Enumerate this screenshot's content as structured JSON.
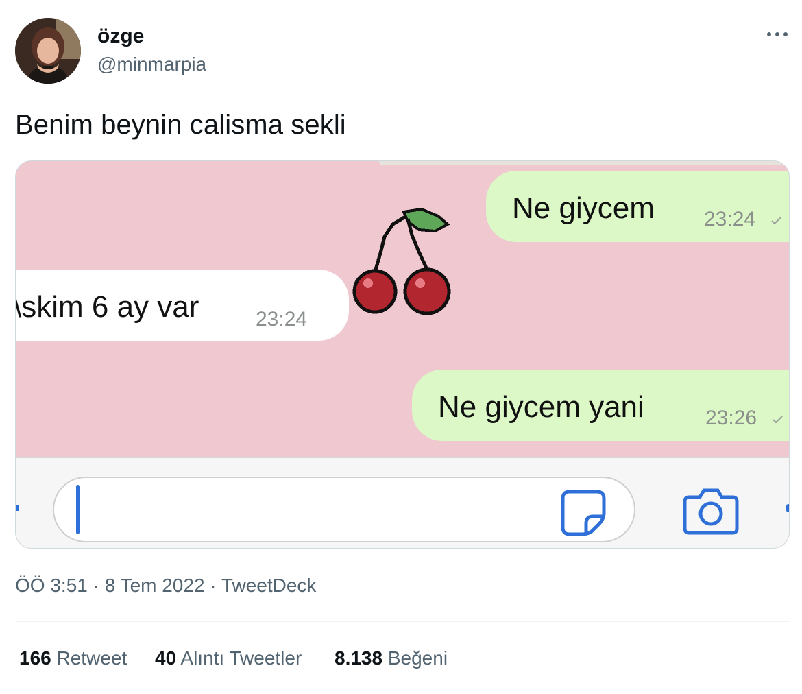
{
  "tweet": {
    "display_name": "özge",
    "handle": "@minmarpia",
    "text": "Benim beynin calisma sekli",
    "more_icon": "more-icon"
  },
  "media": {
    "messages": [
      {
        "direction": "outgoing",
        "text": "Ne giycem",
        "time": "23:24"
      },
      {
        "direction": "incoming",
        "text": "\\skim 6 ay var",
        "time": "23:24"
      },
      {
        "direction": "outgoing",
        "text": "Ne giycem yani",
        "time": "23:26"
      }
    ],
    "sticker_icon": "cherry-icon",
    "input_icons": [
      "sticker-icon",
      "camera-icon"
    ]
  },
  "meta": {
    "timestamp": "ÖÖ 3:51 · 8 Tem 2022 · TweetDeck"
  },
  "stats": {
    "retweets_count": "166",
    "retweets_label": "Retweet",
    "quotes_count": "40",
    "quotes_label": "Alıntı Tweetler",
    "likes_count": "8.138",
    "likes_label": "Beğeni"
  },
  "colors": {
    "chat_background": "#efc8d0",
    "outgoing_bubble": "#dcf8c6",
    "accent_blue": "#2e6fd8",
    "secondary_text": "#536471"
  }
}
